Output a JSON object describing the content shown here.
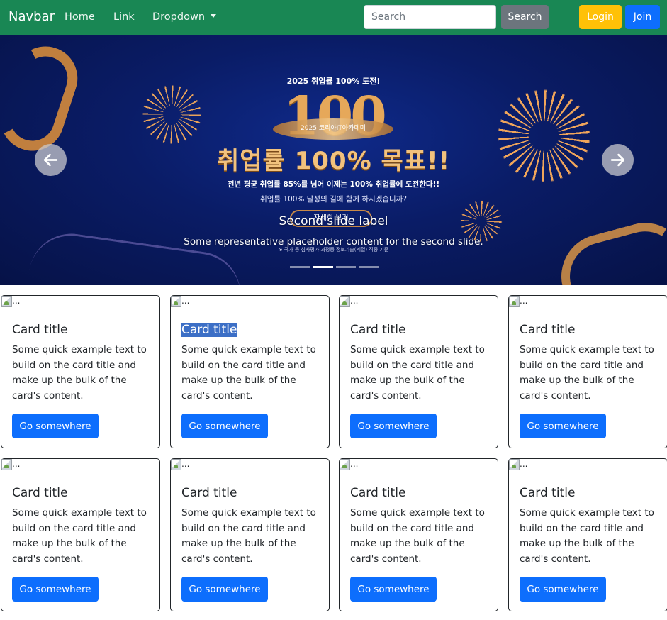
{
  "navbar": {
    "brand": "Navbar",
    "links": [
      "Home",
      "Link",
      "Dropdown"
    ],
    "search_placeholder": "Search",
    "search_button": "Search",
    "login_button": "Login",
    "join_button": "Join",
    "bg_color": "#198754"
  },
  "carousel": {
    "slide_image_text": {
      "top": "2025 취업률 100% 도전!",
      "big_number": "100",
      "ring_text": "2025 코리아IT아카데미",
      "headline": "취업률 100% 목표!!",
      "line1": "전년 평균 취업률 85%를 넘어 이제는 100% 취업률에 도전한다!!",
      "line2": "취업률 100% 달성의 길에 함께 하시겠습니까?",
      "pill": "자세히 보기",
      "footnote": "※ 국가 등 심사평가 과정중 정보기술(계열) 직종 기준"
    },
    "caption_title": "Second slide label",
    "caption_text": "Some representative placeholder content for the second slide.",
    "indicator_count": 4,
    "active_index": 1
  },
  "cards": [
    {
      "img_alt": "...",
      "title": "Card title",
      "text": "Some quick example text to build on the card title and make up the bulk of the card's content.",
      "button": "Go somewhere"
    },
    {
      "img_alt": "...",
      "title": "Card title",
      "text": "Some quick example text to build on the card title and make up the bulk of the card's content.",
      "button": "Go somewhere",
      "title_selected": true
    },
    {
      "img_alt": "...",
      "title": "Card title",
      "text": "Some quick example text to build on the card title and make up the bulk of the card's content.",
      "button": "Go somewhere"
    },
    {
      "img_alt": "...",
      "title": "Card title",
      "text": "Some quick example text to build on the card title and make up the bulk of the card's content.",
      "button": "Go somewhere"
    },
    {
      "img_alt": "...",
      "title": "Card title",
      "text": "Some quick example text to build on the card title and make up the bulk of the card's content.",
      "button": "Go somewhere"
    },
    {
      "img_alt": "...",
      "title": "Card title",
      "text": "Some quick example text to build on the card title and make up the bulk of the card's content.",
      "button": "Go somewhere"
    },
    {
      "img_alt": "...",
      "title": "Card title",
      "text": "Some quick example text to build on the card title and make up the bulk of the card's content.",
      "button": "Go somewhere"
    },
    {
      "img_alt": "...",
      "title": "Card title",
      "text": "Some quick example text to build on the card title and make up the bulk of the card's content.",
      "button": "Go somewhere"
    }
  ],
  "colors": {
    "primary": "#0d6efd",
    "secondary": "#6c757d",
    "warning": "#ffc107",
    "success": "#198754",
    "selection": "#3c6fc6"
  }
}
